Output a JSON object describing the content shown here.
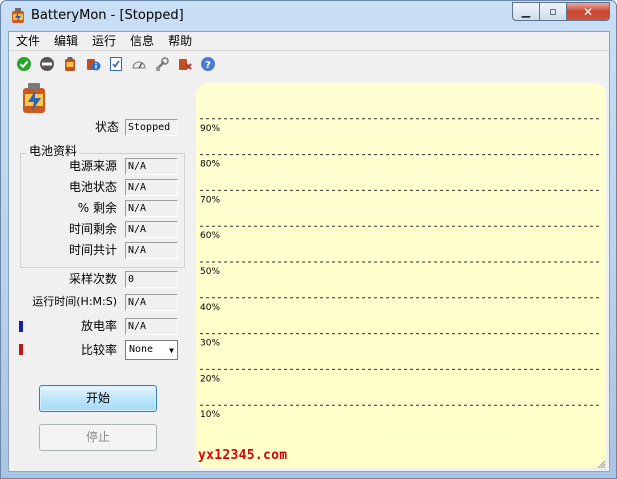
{
  "window": {
    "title": "BatteryMon - [Stopped]"
  },
  "menu": [
    "文件",
    "编辑",
    "运行",
    "信息",
    "帮助"
  ],
  "toolbar": [
    {
      "name": "start-check-icon",
      "color": "#2aa52a"
    },
    {
      "name": "stop-icon",
      "color": "#555555"
    },
    {
      "name": "battery-icon",
      "color": "#c05020"
    },
    {
      "name": "info-icon",
      "color": "#2a6fd0"
    },
    {
      "name": "checklist-icon",
      "color": "#3a6aa8"
    },
    {
      "name": "gauge-icon",
      "color": "#888888"
    },
    {
      "name": "tools-icon",
      "color": "#888888"
    },
    {
      "name": "battery-remove-icon",
      "color": "#c03030"
    },
    {
      "name": "help-icon",
      "color": "#4a7bd0"
    }
  ],
  "status": {
    "label": "状态",
    "value": "Stopped"
  },
  "battery_info": {
    "title": "电池资料",
    "rows": [
      {
        "label": "电源来源",
        "value": "N/A"
      },
      {
        "label": "电池状态",
        "value": "N/A"
      },
      {
        "label": "% 剩余",
        "value": "N/A"
      },
      {
        "label": "时间剩余",
        "value": "N/A"
      },
      {
        "label": "时间共计",
        "value": "N/A"
      }
    ]
  },
  "samples": {
    "label": "采样次数",
    "value": "0"
  },
  "runtime": {
    "label": "运行时间(H:M:S)",
    "value": "N/A"
  },
  "discharge": {
    "label": "放电率",
    "value": "N/A",
    "color": "#1a1ab0"
  },
  "compare": {
    "label": "比较率",
    "value": "None",
    "color": "#c01818"
  },
  "buttons": {
    "start": "开始",
    "stop": "停止"
  },
  "chart_data": {
    "type": "line",
    "series": [],
    "y_ticks": [
      "90%",
      "80%",
      "70%",
      "60%",
      "50%",
      "40%",
      "30%",
      "20%",
      "10%"
    ],
    "ylim": [
      0,
      100
    ],
    "grid": true,
    "background": "#ffffc8"
  },
  "watermark": "yx12345.com"
}
